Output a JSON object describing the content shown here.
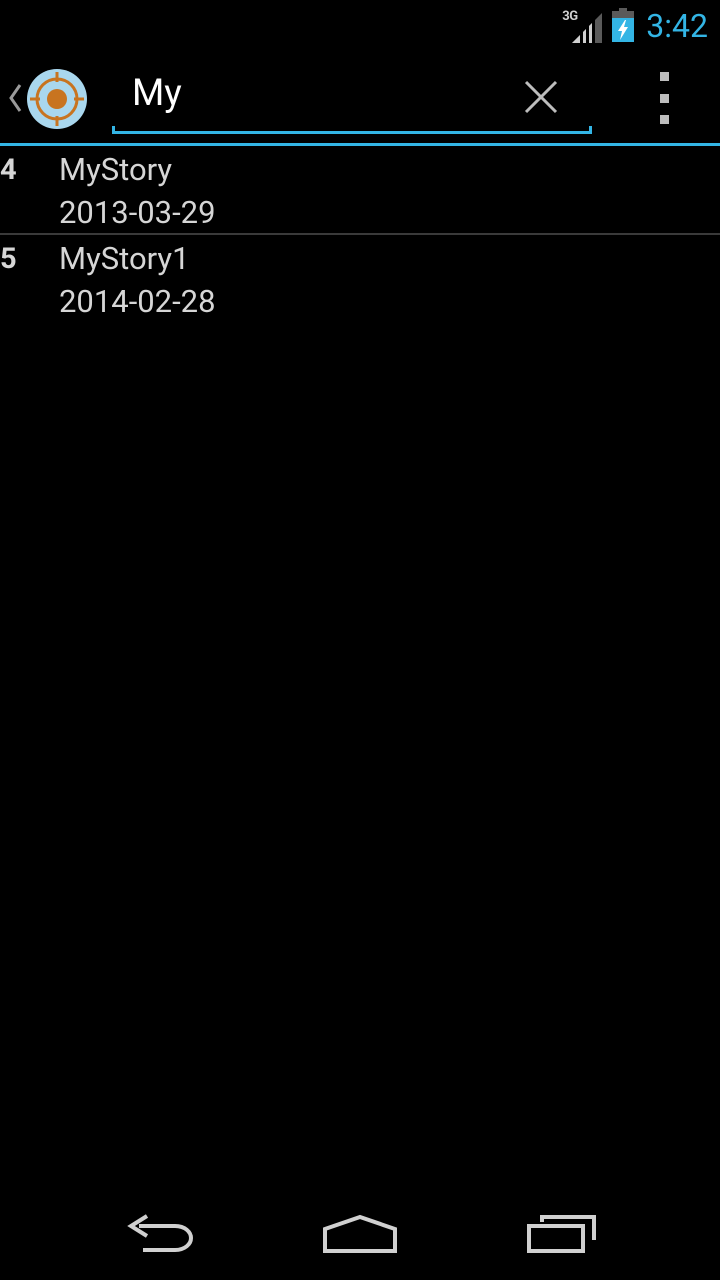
{
  "status_bar": {
    "network_type": "3G",
    "clock": "3:42",
    "accent_color": "#33b5e5"
  },
  "action_bar": {
    "up_icon": "chevron-left-icon",
    "app_icon": "target-icon",
    "search": {
      "value": "My"
    },
    "clear_icon": "close-icon",
    "overflow_icon": "overflow-menu-icon"
  },
  "results": [
    {
      "number": "4",
      "title": "MyStory",
      "date": "2013-03-29"
    },
    {
      "number": "5",
      "title": "MyStory1",
      "date": "2014-02-28"
    }
  ],
  "nav_bar": {
    "back_icon": "back-icon",
    "home_icon": "home-icon",
    "recents_icon": "recents-icon"
  }
}
